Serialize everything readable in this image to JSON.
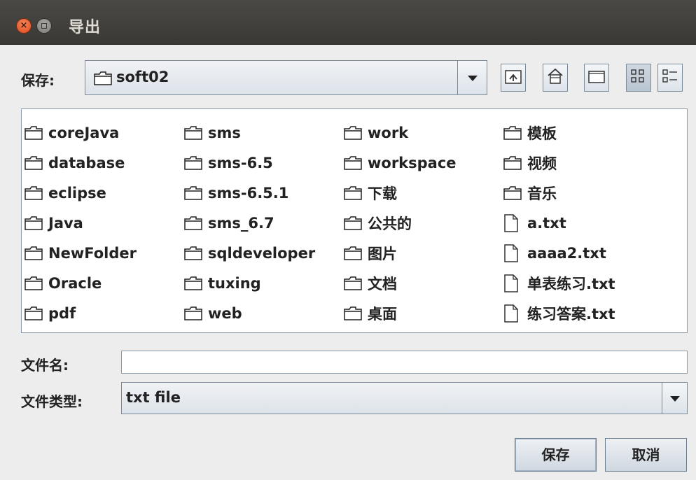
{
  "window": {
    "title": "导出"
  },
  "save_in": {
    "label": "保存:",
    "current_folder": "soft02"
  },
  "toolbar": {
    "buttons": [
      {
        "icon": "up-folder-icon"
      },
      {
        "icon": "home-icon"
      },
      {
        "icon": "new-folder-icon"
      },
      {
        "icon": "list-view-icon"
      },
      {
        "icon": "details-view-icon"
      }
    ]
  },
  "files": {
    "columns": [
      [
        {
          "name": "coreJava",
          "type": "folder"
        },
        {
          "name": "database",
          "type": "folder"
        },
        {
          "name": "eclipse",
          "type": "folder"
        },
        {
          "name": "Java",
          "type": "folder"
        },
        {
          "name": "NewFolder",
          "type": "folder"
        },
        {
          "name": "Oracle",
          "type": "folder"
        },
        {
          "name": "pdf",
          "type": "folder"
        }
      ],
      [
        {
          "name": "sms",
          "type": "folder"
        },
        {
          "name": "sms-6.5",
          "type": "folder"
        },
        {
          "name": "sms-6.5.1",
          "type": "folder"
        },
        {
          "name": "sms_6.7",
          "type": "folder"
        },
        {
          "name": "sqldeveloper",
          "type": "folder"
        },
        {
          "name": "tuxing",
          "type": "folder"
        },
        {
          "name": "web",
          "type": "folder"
        }
      ],
      [
        {
          "name": "work",
          "type": "folder"
        },
        {
          "name": "workspace",
          "type": "folder"
        },
        {
          "name": "下载",
          "type": "folder"
        },
        {
          "name": "公共的",
          "type": "folder"
        },
        {
          "name": "图片",
          "type": "folder"
        },
        {
          "name": "文档",
          "type": "folder"
        },
        {
          "name": "桌面",
          "type": "folder"
        }
      ],
      [
        {
          "name": "模板",
          "type": "folder"
        },
        {
          "name": "视频",
          "type": "folder"
        },
        {
          "name": "音乐",
          "type": "folder"
        },
        {
          "name": "a.txt",
          "type": "file"
        },
        {
          "name": "aaaa2.txt",
          "type": "file"
        },
        {
          "name": "单表练习.txt",
          "type": "file"
        },
        {
          "name": "练习答案.txt",
          "type": "file"
        }
      ]
    ]
  },
  "filename": {
    "label": "文件名:",
    "value": ""
  },
  "filetype": {
    "label": "文件类型:",
    "value": "txt file"
  },
  "actions": {
    "save": "保存",
    "cancel": "取消"
  }
}
